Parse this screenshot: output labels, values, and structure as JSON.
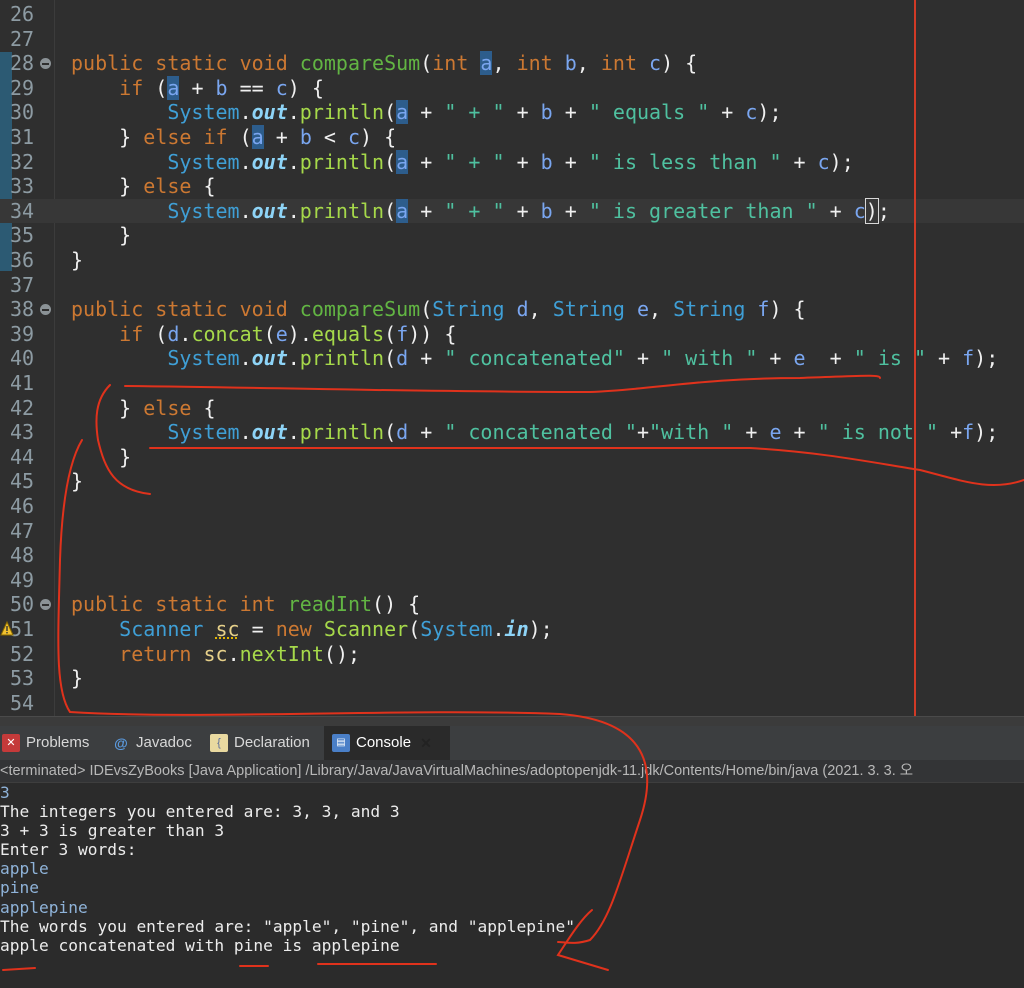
{
  "editor": {
    "lines": [
      {
        "n": "26",
        "tokens": []
      },
      {
        "n": "27",
        "tokens": []
      },
      {
        "n": "28",
        "fold": true,
        "tokens": [
          [
            "kw",
            "public static void "
          ],
          [
            "fn",
            "compareSum"
          ],
          [
            "",
            "("
          ],
          [
            "kw",
            "int "
          ],
          [
            "var hl",
            "a"
          ],
          [
            "",
            ", "
          ],
          [
            "kw",
            "int "
          ],
          [
            "var",
            "b"
          ],
          [
            "",
            ", "
          ],
          [
            "kw",
            "int "
          ],
          [
            "var",
            "c"
          ],
          [
            "",
            ") {"
          ]
        ]
      },
      {
        "n": "29",
        "tokens": [
          [
            "",
            "    "
          ],
          [
            "kw",
            "if"
          ],
          [
            "",
            " ("
          ],
          [
            "var hl",
            "a"
          ],
          [
            "",
            " + "
          ],
          [
            "var",
            "b"
          ],
          [
            "",
            " == "
          ],
          [
            "var",
            "c"
          ],
          [
            "",
            ") {"
          ]
        ]
      },
      {
        "n": "30",
        "tokens": [
          [
            "",
            "        "
          ],
          [
            "cls",
            "System"
          ],
          [
            "",
            "."
          ],
          [
            "fld",
            "out"
          ],
          [
            "",
            "."
          ],
          [
            "mth",
            "println"
          ],
          [
            "",
            "("
          ],
          [
            "var hl",
            "a"
          ],
          [
            "",
            " + "
          ],
          [
            "str",
            "\" + \""
          ],
          [
            "",
            " + "
          ],
          [
            "var",
            "b"
          ],
          [
            "",
            " + "
          ],
          [
            "str",
            "\" equals \""
          ],
          [
            "",
            " + "
          ],
          [
            "var",
            "c"
          ],
          [
            "",
            ");"
          ]
        ]
      },
      {
        "n": "31",
        "tokens": [
          [
            "",
            "    } "
          ],
          [
            "kw",
            "else if"
          ],
          [
            "",
            " ("
          ],
          [
            "var hl",
            "a"
          ],
          [
            "",
            " + "
          ],
          [
            "var",
            "b"
          ],
          [
            "",
            " < "
          ],
          [
            "var",
            "c"
          ],
          [
            "",
            ") {"
          ]
        ]
      },
      {
        "n": "32",
        "tokens": [
          [
            "",
            "        "
          ],
          [
            "cls",
            "System"
          ],
          [
            "",
            "."
          ],
          [
            "fld",
            "out"
          ],
          [
            "",
            "."
          ],
          [
            "mth",
            "println"
          ],
          [
            "",
            "("
          ],
          [
            "var hl",
            "a"
          ],
          [
            "",
            " + "
          ],
          [
            "str",
            "\" + \""
          ],
          [
            "",
            " + "
          ],
          [
            "var",
            "b"
          ],
          [
            "",
            " + "
          ],
          [
            "str",
            "\" is less than \""
          ],
          [
            "",
            " + "
          ],
          [
            "var",
            "c"
          ],
          [
            "",
            ");"
          ]
        ]
      },
      {
        "n": "33",
        "tokens": [
          [
            "",
            "    } "
          ],
          [
            "kw",
            "else"
          ],
          [
            "",
            " {"
          ]
        ]
      },
      {
        "n": "34",
        "current": true,
        "tokens": [
          [
            "",
            "        "
          ],
          [
            "cls",
            "System"
          ],
          [
            "",
            "."
          ],
          [
            "fld",
            "out"
          ],
          [
            "",
            "."
          ],
          [
            "mth",
            "println"
          ],
          [
            "",
            "("
          ],
          [
            "var hl",
            "a"
          ],
          [
            "",
            " + "
          ],
          [
            "str",
            "\" + \""
          ],
          [
            "",
            " + "
          ],
          [
            "var",
            "b"
          ],
          [
            "",
            " + "
          ],
          [
            "str",
            "\" is greater than \""
          ],
          [
            "",
            " + "
          ],
          [
            "var",
            "c"
          ],
          [
            "box",
            ")"
          ],
          [
            "",
            ";"
          ]
        ]
      },
      {
        "n": "35",
        "tokens": [
          [
            "",
            "    }"
          ]
        ]
      },
      {
        "n": "36",
        "tokens": [
          [
            "",
            "}"
          ]
        ]
      },
      {
        "n": "37",
        "tokens": []
      },
      {
        "n": "38",
        "fold": true,
        "tokens": [
          [
            "kw",
            "public static void "
          ],
          [
            "fn",
            "compareSum"
          ],
          [
            "",
            "("
          ],
          [
            "cls",
            "String "
          ],
          [
            "var",
            "d"
          ],
          [
            "",
            ", "
          ],
          [
            "cls",
            "String "
          ],
          [
            "var",
            "e"
          ],
          [
            "",
            ", "
          ],
          [
            "cls",
            "String "
          ],
          [
            "var",
            "f"
          ],
          [
            "",
            ") {"
          ]
        ]
      },
      {
        "n": "39",
        "tokens": [
          [
            "",
            "    "
          ],
          [
            "kw",
            "if"
          ],
          [
            "",
            " ("
          ],
          [
            "var",
            "d"
          ],
          [
            "",
            "."
          ],
          [
            "mth",
            "concat"
          ],
          [
            "",
            "("
          ],
          [
            "var",
            "e"
          ],
          [
            ")",
            ")."
          ],
          [
            "mth",
            "equals"
          ],
          [
            "",
            "("
          ],
          [
            "var",
            "f"
          ],
          [
            "",
            ")) {"
          ]
        ]
      },
      {
        "n": "40",
        "tokens": [
          [
            "",
            "        "
          ],
          [
            "cls",
            "System"
          ],
          [
            "",
            "."
          ],
          [
            "fld",
            "out"
          ],
          [
            "",
            "."
          ],
          [
            "mth",
            "println"
          ],
          [
            "",
            "("
          ],
          [
            "var",
            "d"
          ],
          [
            "",
            " + "
          ],
          [
            "str",
            "\" concatenated\""
          ],
          [
            "",
            " + "
          ],
          [
            "str",
            "\" with \""
          ],
          [
            "",
            " + "
          ],
          [
            "var",
            "e"
          ],
          [
            "",
            "  + "
          ],
          [
            "str",
            "\" is \""
          ],
          [
            "",
            " + "
          ],
          [
            "var",
            "f"
          ],
          [
            "",
            ");"
          ]
        ]
      },
      {
        "n": "41",
        "tokens": []
      },
      {
        "n": "42",
        "tokens": [
          [
            "",
            "    } "
          ],
          [
            "kw",
            "else"
          ],
          [
            "",
            " {"
          ]
        ]
      },
      {
        "n": "43",
        "tokens": [
          [
            "",
            "        "
          ],
          [
            "cls",
            "System"
          ],
          [
            "",
            "."
          ],
          [
            "fld",
            "out"
          ],
          [
            "",
            "."
          ],
          [
            "mth",
            "println"
          ],
          [
            "",
            "("
          ],
          [
            "var",
            "d"
          ],
          [
            "",
            " + "
          ],
          [
            "str",
            "\" concatenated \""
          ],
          [
            "",
            "+"
          ],
          [
            "str",
            "\"with \""
          ],
          [
            "",
            " + "
          ],
          [
            "var",
            "e"
          ],
          [
            "",
            " + "
          ],
          [
            "str",
            "\" is not \""
          ],
          [
            "",
            " +"
          ],
          [
            "var",
            "f"
          ],
          [
            "",
            ");"
          ]
        ]
      },
      {
        "n": "44",
        "tokens": [
          [
            "",
            "    }"
          ]
        ]
      },
      {
        "n": "45",
        "tokens": [
          [
            "",
            "}"
          ]
        ]
      },
      {
        "n": "46",
        "tokens": []
      },
      {
        "n": "47",
        "tokens": []
      },
      {
        "n": "48",
        "tokens": []
      },
      {
        "n": "49",
        "tokens": []
      },
      {
        "n": "50",
        "fold": true,
        "tokens": [
          [
            "kw",
            "public static int "
          ],
          [
            "fn",
            "readInt"
          ],
          [
            "",
            "() {"
          ]
        ]
      },
      {
        "n": "51",
        "warning": true,
        "tokens": [
          [
            "",
            "    "
          ],
          [
            "cls",
            "Scanner "
          ],
          [
            "lvar warnline",
            "sc"
          ],
          [
            "",
            " = "
          ],
          [
            "kw",
            "new "
          ],
          [
            "mth",
            "Scanner"
          ],
          [
            "",
            "("
          ],
          [
            "cls",
            "System"
          ],
          [
            "",
            "."
          ],
          [
            "fld",
            "in"
          ],
          [
            "",
            ");"
          ]
        ]
      },
      {
        "n": "52",
        "tokens": [
          [
            "",
            "    "
          ],
          [
            "kw",
            "return "
          ],
          [
            "lvar",
            "sc"
          ],
          [
            "",
            "."
          ],
          [
            "mth",
            "nextInt"
          ],
          [
            "",
            "();"
          ]
        ]
      },
      {
        "n": "53",
        "tokens": [
          [
            "",
            "}"
          ]
        ]
      },
      {
        "n": "54",
        "tokens": []
      }
    ]
  },
  "tabs": [
    {
      "label": "Problems",
      "icon": "problems-icon",
      "active": false
    },
    {
      "label": "Javadoc",
      "icon": "javadoc-icon",
      "active": false
    },
    {
      "label": "Declaration",
      "icon": "declaration-icon",
      "active": false
    },
    {
      "label": "Console",
      "icon": "console-icon",
      "active": true
    }
  ],
  "console": {
    "status": "<terminated> IDEvsZyBooks [Java Application] /Library/Java/JavaVirtualMachines/adoptopenjdk-11.jdk/Contents/Home/bin/java  (2021. 3. 3. 오",
    "lines": [
      {
        "text": "3",
        "type": "in"
      },
      {
        "text": "The integers you entered are: 3, 3, and 3",
        "type": "out"
      },
      {
        "text": "3 + 3 is greater than 3",
        "type": "out"
      },
      {
        "text": "Enter 3 words:",
        "type": "out"
      },
      {
        "text": "apple",
        "type": "in"
      },
      {
        "text": "pine",
        "type": "in"
      },
      {
        "text": "applepine",
        "type": "in"
      },
      {
        "text": "The words you entered are: \"apple\", \"pine\", and \"applepine\"",
        "type": "out"
      },
      {
        "text": "apple concatenated with pine is applepine",
        "type": "out"
      }
    ]
  },
  "colors": {
    "annotation": "#e0321c",
    "keyword": "#cc7832",
    "string": "#4fc1a0"
  }
}
